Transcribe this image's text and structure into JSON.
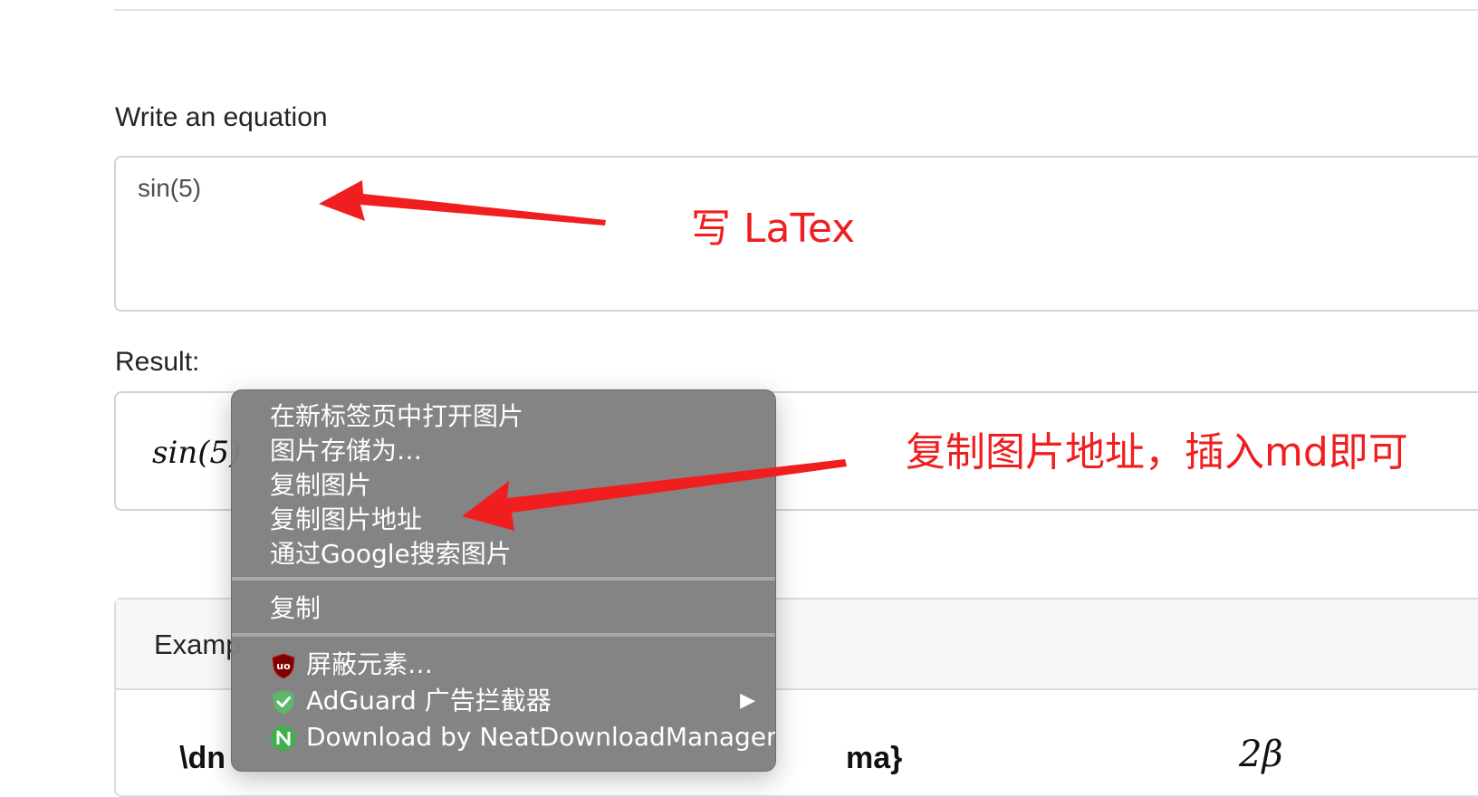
{
  "form": {
    "write_label": "Write an equation",
    "equation_value": "sin(5)",
    "result_label": "Result:",
    "result_math": "sin(5)"
  },
  "examples": {
    "title": "Examp",
    "code_left": "\\dn",
    "code_right": "ma}",
    "math_right": "2β"
  },
  "context_menu": {
    "items": [
      {
        "label": "在新标签页中打开图片"
      },
      {
        "label": "图片存储为…"
      },
      {
        "label": "复制图片"
      },
      {
        "label": "复制图片地址"
      },
      {
        "label": "通过Google搜索图片"
      },
      {
        "label": "复制"
      },
      {
        "label": "屏蔽元素…",
        "icon": "ublock-shield-icon"
      },
      {
        "label": "AdGuard 广告拦截器",
        "icon": "adguard-shield-icon",
        "submenu_arrow": "▶"
      },
      {
        "label": "Download by NeatDownloadManager",
        "icon": "neat-download-manager-icon"
      }
    ]
  },
  "annotations": {
    "write_latex": "写 LaTex",
    "copy_address": "复制图片地址，插入md即可",
    "color": "#f01e1e"
  },
  "colors": {
    "menu_bg": "#808080",
    "annotation": "#f01e1e",
    "input_border": "#ced4da"
  }
}
